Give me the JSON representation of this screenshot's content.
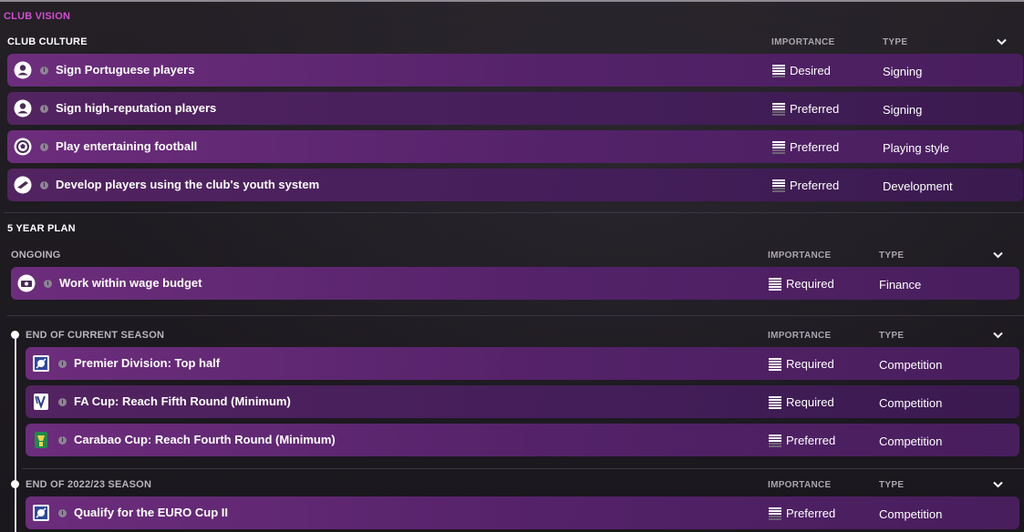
{
  "page_title": "CLUB VISION",
  "club_culture": {
    "title": "CLUB CULTURE",
    "col_importance": "IMPORTANCE",
    "col_type": "TYPE",
    "rows": [
      {
        "label": "Sign Portuguese players",
        "importance": "Desired",
        "importance_level": 4,
        "type": "Signing",
        "icon": "person-icon"
      },
      {
        "label": "Sign high-reputation players",
        "importance": "Preferred",
        "importance_level": 3,
        "type": "Signing",
        "icon": "person-icon"
      },
      {
        "label": "Play entertaining football",
        "importance": "Preferred",
        "importance_level": 3,
        "type": "Playing style",
        "icon": "football-icon"
      },
      {
        "label": "Develop players using the club's youth system",
        "importance": "Preferred",
        "importance_level": 3,
        "type": "Development",
        "icon": "boot-icon"
      }
    ]
  },
  "five_year_plan": {
    "title": "5 YEAR PLAN",
    "ongoing": {
      "title": "ONGOING",
      "col_importance": "IMPORTANCE",
      "col_type": "TYPE",
      "rows": [
        {
          "label": "Work within wage budget",
          "importance": "Required",
          "importance_level": 5,
          "type": "Finance",
          "icon": "money-icon"
        }
      ]
    },
    "current_season": {
      "title": "END OF CURRENT SEASON",
      "col_importance": "IMPORTANCE",
      "col_type": "TYPE",
      "rows": [
        {
          "label": "Premier Division: Top half",
          "importance": "Required",
          "importance_level": 5,
          "type": "Competition",
          "icon": "league-logo-icon"
        },
        {
          "label": "FA Cup: Reach Fifth Round (Minimum)",
          "importance": "Required",
          "importance_level": 5,
          "type": "Competition",
          "icon": "fa-cup-logo-icon"
        },
        {
          "label": "Carabao Cup: Reach Fourth Round (Minimum)",
          "importance": "Preferred",
          "importance_level": 3,
          "type": "Competition",
          "icon": "carabao-cup-logo-icon"
        }
      ]
    },
    "season_2022_23": {
      "title": "END OF 2022/23 SEASON",
      "col_importance": "IMPORTANCE",
      "col_type": "TYPE",
      "rows": [
        {
          "label": "Qualify for the EURO Cup II",
          "importance": "Preferred",
          "importance_level": 3,
          "type": "Competition",
          "icon": "euro-cup-logo-icon"
        }
      ]
    }
  },
  "colors": {
    "title_accent": "#d24fd0",
    "row_purple": "#6e2d80",
    "background": "#1d1a20"
  }
}
